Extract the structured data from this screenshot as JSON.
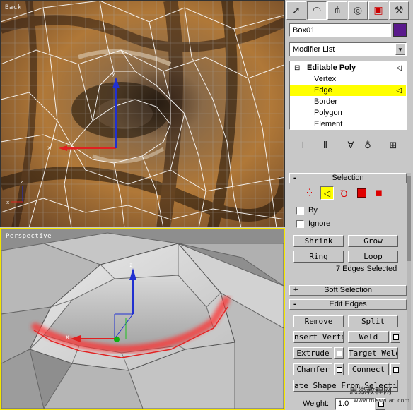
{
  "viewports": {
    "back_label": "Back",
    "perspective_label": "Perspective"
  },
  "panel": {
    "tabs": [
      "create-icon",
      "modify-icon",
      "hierarchy-icon",
      "motion-icon",
      "display-icon",
      "utilities-icon"
    ],
    "object_name": "Box01",
    "object_color": "#5a1a8c",
    "modifier_list": "Modifier List",
    "stack": {
      "root": "Editable Poly",
      "items": [
        "Vertex",
        "Edge",
        "Border",
        "Polygon",
        "Element"
      ],
      "selected": "Edge"
    },
    "selection": {
      "title": "Selection",
      "by_label": "By",
      "ignore_label": "Ignore",
      "shrink": "Shrink",
      "grow": "Grow",
      "ring": "Ring",
      "loop": "Loop",
      "status": "7 Edges Selected"
    },
    "soft_selection": {
      "title": "Soft Selection"
    },
    "edit_edges": {
      "title": "Edit Edges",
      "remove": "Remove",
      "split": "Split",
      "insert_vertex": "nsert Verte",
      "weld": "Weld",
      "extrude": "Extrude",
      "target_weld": "Target Weld",
      "chamfer": "Chamfer",
      "connect": "Connect",
      "create_shape": "ate Shape From Selecti",
      "weight_label": "Weight:",
      "weight_value": "1.0"
    },
    "watermark": "思缘教程网",
    "watermark_url": "www.missyuan.com"
  },
  "colors": {
    "highlight": "#ffff00",
    "active_viewport_border": "#f4e600",
    "edge_selection": "#e02020"
  }
}
